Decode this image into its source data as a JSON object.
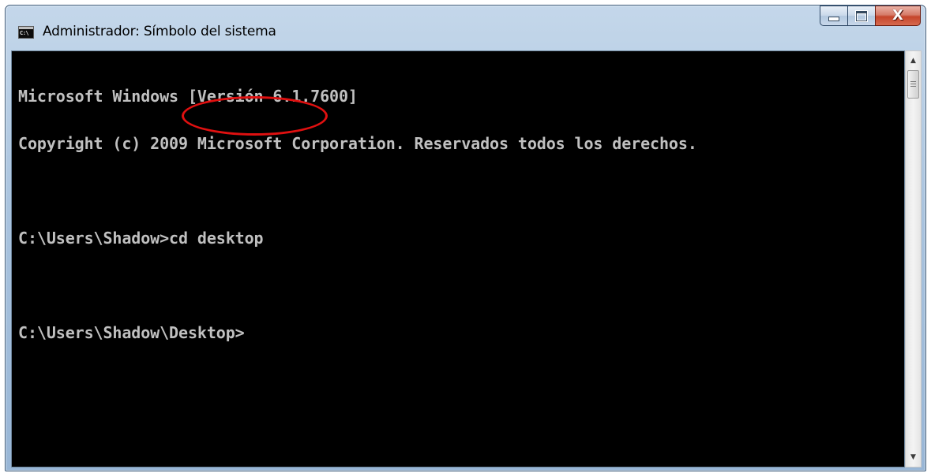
{
  "window": {
    "title": "Administrador: Símbolo del sistema",
    "app_icon_text": "C:\\",
    "close_label": "X",
    "colors": {
      "titlebar": "#a9c3de",
      "close_button": "#c5452b",
      "console_bg": "#000000",
      "console_text": "#c0c0c0",
      "highlight": "#e01010"
    },
    "icons": [
      "cmd-app-icon",
      "minimize-icon",
      "maximize-icon",
      "close-icon",
      "scroll-up-arrow-icon",
      "scroll-down-arrow-icon"
    ]
  },
  "console": {
    "lines": [
      "Microsoft Windows [Versión 6.1.7600]",
      "Copyright (c) 2009 Microsoft Corporation. Reservados todos los derechos.",
      "",
      "C:\\Users\\Shadow>cd desktop",
      "",
      "C:\\Users\\Shadow\\Desktop>"
    ]
  },
  "scrollbar": {
    "up_arrow": "▲",
    "down_arrow": "▼"
  }
}
